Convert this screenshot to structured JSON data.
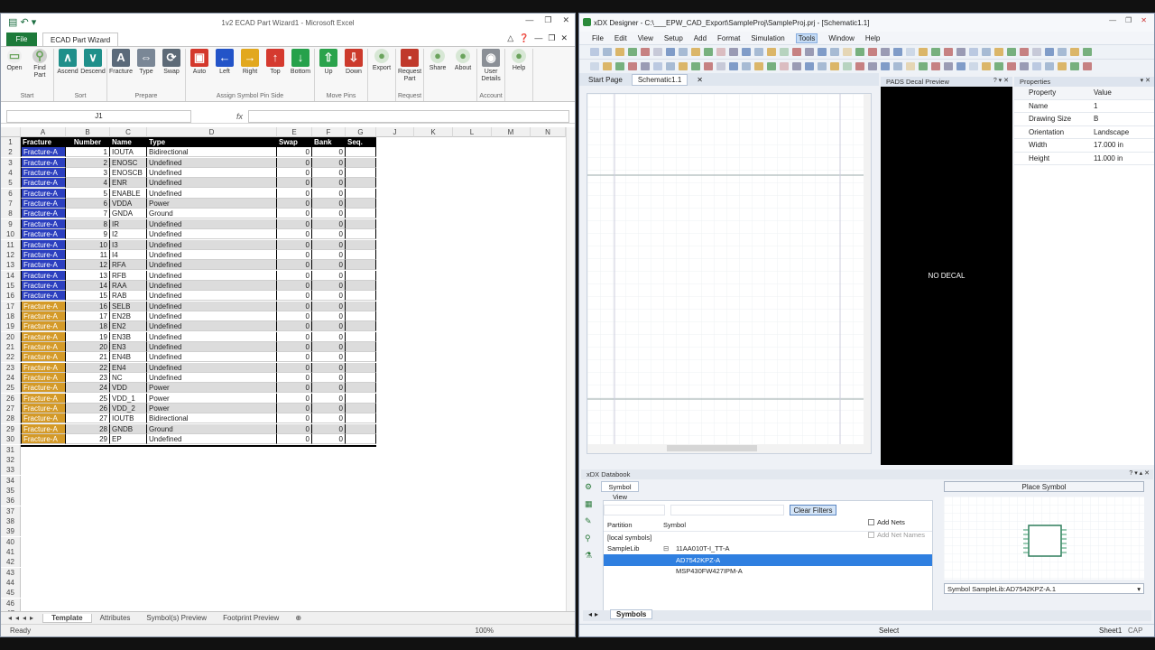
{
  "excel": {
    "title": "1v2 ECAD Part Wizard1 - Microsoft Excel",
    "file_tab": "File",
    "wizard_tab": "ECAD Part Wizard",
    "groups": [
      {
        "label": "Start",
        "buttons": [
          {
            "label": "Open",
            "icon": "file-icon",
            "color": "#eeeeee"
          },
          {
            "label": "Find Part",
            "icon": "magnifier-icon",
            "color": "#cfcfcf"
          }
        ]
      },
      {
        "label": "Sort",
        "buttons": [
          {
            "label": "Ascend",
            "icon": "up-chevron-icon",
            "color": "#1f8f8a"
          },
          {
            "label": "Descend",
            "icon": "down-chevron-icon",
            "color": "#1f8f8a"
          }
        ]
      },
      {
        "label": "Prepare",
        "buttons": [
          {
            "label": "Fracture",
            "icon": "fracture-icon",
            "color": "#5b6a7a"
          },
          {
            "label": "Type",
            "icon": "type-icon",
            "color": "#7a8796"
          },
          {
            "label": "Swap",
            "icon": "swap-icon",
            "color": "#5d6a77"
          }
        ]
      },
      {
        "label": "Assign Symbol Pin Side",
        "buttons": [
          {
            "label": "Auto",
            "icon": "car-icon",
            "color": "#d4382c"
          },
          {
            "label": "Left",
            "icon": "arrow-left-icon",
            "color": "#2354c8"
          },
          {
            "label": "Right",
            "icon": "arrow-right-icon",
            "color": "#e2a81e"
          },
          {
            "label": "Top",
            "icon": "arrow-up-icon",
            "color": "#d53a2f"
          },
          {
            "label": "Bottom",
            "icon": "arrow-down-icon",
            "color": "#26a14b"
          }
        ]
      },
      {
        "label": "Move Pins",
        "buttons": [
          {
            "label": "Up",
            "icon": "up-green-icon",
            "color": "#2aa34c"
          },
          {
            "label": "Down",
            "icon": "down-red-icon",
            "color": "#cc3a2c"
          }
        ]
      },
      {
        "label": "",
        "buttons": [
          {
            "label": "Export",
            "icon": "export-icon",
            "color": "#d7e7d5"
          }
        ]
      },
      {
        "label": "Request",
        "buttons": [
          {
            "label": "Request Part",
            "icon": "chip-icon",
            "color": "#c0392b"
          }
        ]
      },
      {
        "label": "",
        "buttons": [
          {
            "label": "Share",
            "icon": "share-icon",
            "color": "#d7e7d5"
          },
          {
            "label": "About",
            "icon": "about-icon",
            "color": "#d7e7d5"
          }
        ]
      },
      {
        "label": "Account",
        "buttons": [
          {
            "label": "User Details",
            "icon": "user-icon",
            "color": "#8a8f96"
          }
        ]
      },
      {
        "label": "",
        "buttons": [
          {
            "label": "Help",
            "icon": "help-icon",
            "color": "#d7e7d5"
          }
        ]
      }
    ],
    "name_box": "J1",
    "fx": "fx",
    "columns": [
      "A",
      "B",
      "C",
      "D",
      "E",
      "F",
      "G",
      "J",
      "K",
      "L",
      "M",
      "N"
    ],
    "headers": [
      "Fracture",
      "Number",
      "Name",
      "Type",
      "Swap",
      "Bank",
      "Seq."
    ],
    "rows": [
      {
        "fracture": "Fracture-A",
        "number": "1",
        "name": "IOUTA",
        "type": "Bidirectional",
        "swap": "0",
        "bank": "0",
        "group": "blue"
      },
      {
        "fracture": "Fracture-A",
        "number": "2",
        "name": "ENOSC",
        "type": "Undefined",
        "swap": "0",
        "bank": "0",
        "group": "blue"
      },
      {
        "fracture": "Fracture-A",
        "number": "3",
        "name": "ENOSCB",
        "type": "Undefined",
        "swap": "0",
        "bank": "0",
        "group": "blue"
      },
      {
        "fracture": "Fracture-A",
        "number": "4",
        "name": "ENR",
        "type": "Undefined",
        "swap": "0",
        "bank": "0",
        "group": "blue"
      },
      {
        "fracture": "Fracture-A",
        "number": "5",
        "name": "ENABLE",
        "type": "Undefined",
        "swap": "0",
        "bank": "0",
        "group": "blue"
      },
      {
        "fracture": "Fracture-A",
        "number": "6",
        "name": "VDDA",
        "type": "Power",
        "swap": "0",
        "bank": "0",
        "group": "blue"
      },
      {
        "fracture": "Fracture-A",
        "number": "7",
        "name": "GNDA",
        "type": "Ground",
        "swap": "0",
        "bank": "0",
        "group": "blue"
      },
      {
        "fracture": "Fracture-A",
        "number": "8",
        "name": "IR",
        "type": "Undefined",
        "swap": "0",
        "bank": "0",
        "group": "blue"
      },
      {
        "fracture": "Fracture-A",
        "number": "9",
        "name": "I2",
        "type": "Undefined",
        "swap": "0",
        "bank": "0",
        "group": "blue"
      },
      {
        "fracture": "Fracture-A",
        "number": "10",
        "name": "I3",
        "type": "Undefined",
        "swap": "0",
        "bank": "0",
        "group": "blue"
      },
      {
        "fracture": "Fracture-A",
        "number": "11",
        "name": "I4",
        "type": "Undefined",
        "swap": "0",
        "bank": "0",
        "group": "blue"
      },
      {
        "fracture": "Fracture-A",
        "number": "12",
        "name": "RFA",
        "type": "Undefined",
        "swap": "0",
        "bank": "0",
        "group": "blue"
      },
      {
        "fracture": "Fracture-A",
        "number": "13",
        "name": "RFB",
        "type": "Undefined",
        "swap": "0",
        "bank": "0",
        "group": "blue"
      },
      {
        "fracture": "Fracture-A",
        "number": "14",
        "name": "RAA",
        "type": "Undefined",
        "swap": "0",
        "bank": "0",
        "group": "blue"
      },
      {
        "fracture": "Fracture-A",
        "number": "15",
        "name": "RAB",
        "type": "Undefined",
        "swap": "0",
        "bank": "0",
        "group": "blue"
      },
      {
        "fracture": "Fracture-A",
        "number": "16",
        "name": "SELB",
        "type": "Undefined",
        "swap": "0",
        "bank": "0",
        "group": "orange"
      },
      {
        "fracture": "Fracture-A",
        "number": "17",
        "name": "EN2B",
        "type": "Undefined",
        "swap": "0",
        "bank": "0",
        "group": "orange"
      },
      {
        "fracture": "Fracture-A",
        "number": "18",
        "name": "EN2",
        "type": "Undefined",
        "swap": "0",
        "bank": "0",
        "group": "orange"
      },
      {
        "fracture": "Fracture-A",
        "number": "19",
        "name": "EN3B",
        "type": "Undefined",
        "swap": "0",
        "bank": "0",
        "group": "orange"
      },
      {
        "fracture": "Fracture-A",
        "number": "20",
        "name": "EN3",
        "type": "Undefined",
        "swap": "0",
        "bank": "0",
        "group": "orange"
      },
      {
        "fracture": "Fracture-A",
        "number": "21",
        "name": "EN4B",
        "type": "Undefined",
        "swap": "0",
        "bank": "0",
        "group": "orange"
      },
      {
        "fracture": "Fracture-A",
        "number": "22",
        "name": "EN4",
        "type": "Undefined",
        "swap": "0",
        "bank": "0",
        "group": "orange"
      },
      {
        "fracture": "Fracture-A",
        "number": "23",
        "name": "NC",
        "type": "Undefined",
        "swap": "0",
        "bank": "0",
        "group": "orange"
      },
      {
        "fracture": "Fracture-A",
        "number": "24",
        "name": "VDD",
        "type": "Power",
        "swap": "0",
        "bank": "0",
        "group": "orange"
      },
      {
        "fracture": "Fracture-A",
        "number": "25",
        "name": "VDD_1",
        "type": "Power",
        "swap": "0",
        "bank": "0",
        "group": "orange"
      },
      {
        "fracture": "Fracture-A",
        "number": "26",
        "name": "VDD_2",
        "type": "Power",
        "swap": "0",
        "bank": "0",
        "group": "orange"
      },
      {
        "fracture": "Fracture-A",
        "number": "27",
        "name": "IOUTB",
        "type": "Bidirectional",
        "swap": "0",
        "bank": "0",
        "group": "orange"
      },
      {
        "fracture": "Fracture-A",
        "number": "28",
        "name": "GNDB",
        "type": "Ground",
        "swap": "0",
        "bank": "0",
        "group": "orange"
      },
      {
        "fracture": "Fracture-A",
        "number": "29",
        "name": "EP",
        "type": "Undefined",
        "swap": "0",
        "bank": "0",
        "group": "orange"
      }
    ],
    "row_count": 49,
    "sheet_tabs": [
      "Template",
      "Attributes",
      "Symbol(s) Preview",
      "Footprint Preview"
    ],
    "status": "Ready",
    "zoom": "100%",
    "colors": {
      "blue": "#2b3fbf",
      "orange": "#d49a28",
      "header": "#000000",
      "border": "#000000"
    }
  },
  "xdx": {
    "title": "xDX Designer - C:\\___EPW_CAD_Export\\SampleProj\\SampleProj.prj - [Schematic1.1]",
    "menu": [
      "File",
      "Edit",
      "View",
      "Setup",
      "Add",
      "Format",
      "Simulation",
      "Tools",
      "Window",
      "Help"
    ],
    "menu_selected": "Tools",
    "doc_tabs": [
      "Start Page",
      "Schematic1.1"
    ],
    "decal_title": "PADS Decal Preview",
    "decal_text": "NO DECAL",
    "props_title": "Properties",
    "props_header": [
      "Property",
      "Value"
    ],
    "props": [
      {
        "k": "Name",
        "v": "1"
      },
      {
        "k": "Drawing Size",
        "v": "B"
      },
      {
        "k": "Orientation",
        "v": "Landscape"
      },
      {
        "k": "Width",
        "v": "17.000 in"
      },
      {
        "k": "Height",
        "v": "11.000 in"
      }
    ],
    "databook_title": "xDX Databook",
    "symbol_view_tab": "Symbol View",
    "clear_filters": "Clear Filters",
    "table_headers": [
      "Partition",
      "Symbol"
    ],
    "tree": [
      {
        "partition": "[local symbols]",
        "symbol": ""
      },
      {
        "partition": "SampleLib",
        "symbol": "11AA010T-I_TT-A"
      },
      {
        "partition": "",
        "symbol": "AD7542KPZ-A"
      },
      {
        "partition": "",
        "symbol": "MSP430FW427IPM-A"
      }
    ],
    "add_nets": "Add Nets",
    "add_net_names": "Add Net Names",
    "place_symbol": "Place Symbol",
    "symbol_select": "Symbol SampleLib:AD7542KPZ-A.1",
    "symbols_tab": "Symbols",
    "status_select": "Select",
    "status_sheet": "Sheet1",
    "status_cap": "CAP"
  }
}
